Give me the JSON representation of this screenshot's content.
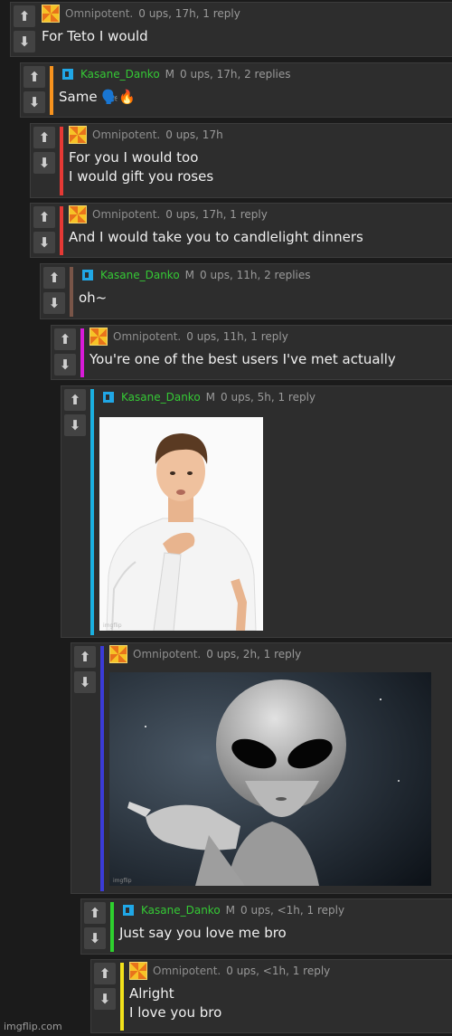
{
  "comments": [
    {
      "user": "Omnipotent.",
      "stats": "0 ups, 17h, 1 reply",
      "text": "For Teto I would"
    },
    {
      "user": "Kasane_Danko",
      "flair": "M",
      "stats": "0 ups, 17h, 2 replies",
      "text": "Same 🗣️🔥"
    },
    {
      "user": "Omnipotent.",
      "stats": "0 ups, 17h",
      "text": "For you I would too\nI would gift you roses"
    },
    {
      "user": "Omnipotent.",
      "stats": "0 ups, 17h, 1 reply",
      "text": "And I would take you to candlelight dinners"
    },
    {
      "user": "Kasane_Danko",
      "flair": "M",
      "stats": "0 ups, 11h, 2 replies",
      "text": "oh~"
    },
    {
      "user": "Omnipotent.",
      "stats": "0 ups, 11h, 1 reply",
      "text": "You're one of the best users I've met actually"
    },
    {
      "user": "Kasane_Danko",
      "flair": "M",
      "stats": "0 ups, 5h, 1 reply",
      "image": "photo-man-hand-on-chest"
    },
    {
      "user": "Omnipotent.",
      "stats": "0 ups, 2h, 1 reply",
      "image": "grey-alien-pointing"
    },
    {
      "user": "Kasane_Danko",
      "flair": "M",
      "stats": "0 ups, <1h, 1 reply",
      "text": "Just say you love me bro"
    },
    {
      "user": "Omnipotent.",
      "stats": "0 ups, <1h, 1 reply",
      "text": "Alright\nI love you bro"
    }
  ],
  "vote_icons": {
    "up": "arrow-up-icon",
    "down": "arrow-down-icon"
  },
  "colors": {
    "background": "#1b1b1b",
    "panel": "#2d2d2d",
    "username_green": "#35c935",
    "bars": [
      "#f7931e",
      "#e53935",
      "#e53935",
      "#795548",
      "#d81bd8",
      "#1ab0e0",
      "#3b3bd6",
      "#2ed12e",
      "#f2e21b"
    ]
  },
  "watermark": "imgflip.com"
}
